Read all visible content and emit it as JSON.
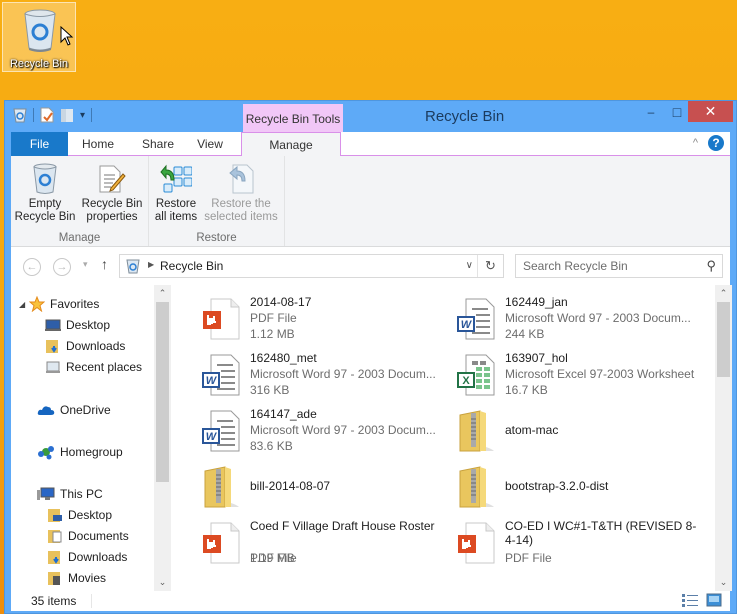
{
  "desktop": {
    "icon_label": "Recycle Bin",
    "icon": "recycle-bin-icon"
  },
  "window": {
    "title": "Recycle Bin",
    "context_tab_group": "Recycle Bin Tools",
    "controls": {
      "minimize": "–",
      "maximize": "□",
      "close": "✕"
    },
    "colors": {
      "frame": "#5eaaf7",
      "file_tab": "#1979ca",
      "context_tab": "#f1c7f7",
      "close": "#c75050"
    }
  },
  "quick_access": {
    "items": [
      {
        "icon": "recycle-bin-icon"
      },
      {
        "icon": "properties-icon"
      },
      {
        "icon": "folder-icon"
      },
      {
        "icon": "customize-dropdown-icon",
        "label": "▾"
      }
    ]
  },
  "ribbon_tabs": [
    {
      "label": "File",
      "active": false
    },
    {
      "label": "Home",
      "active": false
    },
    {
      "label": "Share",
      "active": false
    },
    {
      "label": "View",
      "active": false
    },
    {
      "label": "Manage",
      "active": true
    }
  ],
  "ribbon_right": {
    "collapse": "^",
    "help": "?"
  },
  "ribbon": {
    "groups": [
      {
        "label": "Manage",
        "buttons": [
          {
            "label_1": "Empty",
            "label_2": "Recycle Bin",
            "icon": "empty-recycle-bin-icon",
            "enabled": true
          },
          {
            "label_1": "Recycle Bin",
            "label_2": "properties",
            "icon": "properties-icon",
            "enabled": true
          }
        ]
      },
      {
        "label": "Restore",
        "buttons": [
          {
            "label_1": "Restore",
            "label_2": "all items",
            "icon": "restore-all-icon",
            "enabled": true
          },
          {
            "label_1": "Restore the",
            "label_2": "selected items",
            "icon": "restore-selected-icon",
            "enabled": false
          }
        ]
      }
    ]
  },
  "address_bar": {
    "back": "←",
    "forward": "→",
    "recent": "▾",
    "up": "↑",
    "path": "Recycle Bin",
    "dropdown": "∨",
    "refresh": "↻",
    "search_placeholder": "Search Recycle Bin",
    "search_icon": "⌕"
  },
  "nav_pane": {
    "items": [
      {
        "label": "Favorites",
        "icon": "star-icon",
        "level": 0,
        "expanded": true
      },
      {
        "label": "Desktop",
        "icon": "desktop-icon",
        "level": 1
      },
      {
        "label": "Downloads",
        "icon": "downloads-folder-icon",
        "level": 1
      },
      {
        "label": "Recent places",
        "icon": "recent-places-icon",
        "level": 1
      },
      {
        "label": "OneDrive",
        "icon": "onedrive-icon",
        "level": 0
      },
      {
        "label": "Homegroup",
        "icon": "homegroup-icon",
        "level": 0
      },
      {
        "label": "This PC",
        "icon": "this-pc-icon",
        "level": 0
      },
      {
        "label": "Desktop",
        "icon": "desktop-folder-icon",
        "level": 1
      },
      {
        "label": "Documents",
        "icon": "documents-folder-icon",
        "level": 1
      },
      {
        "label": "Downloads",
        "icon": "downloads-folder-icon",
        "level": 1
      },
      {
        "label": "Movies",
        "icon": "movies-folder-icon",
        "level": 1
      }
    ]
  },
  "files": [
    {
      "name": "2014-08-17",
      "type": "PDF File",
      "size": "1.12 MB",
      "icon": "pdf-file-icon"
    },
    {
      "name": "162449_jan",
      "type": "Microsoft Word 97 - 2003 Docum...",
      "size": "244 KB",
      "icon": "word-document-icon"
    },
    {
      "name": "162480_met",
      "type": "Microsoft Word 97 - 2003 Docum...",
      "size": "316 KB",
      "icon": "word-document-icon"
    },
    {
      "name": "163907_hol",
      "type": "Microsoft Excel 97-2003 Worksheet",
      "size": "16.7 KB",
      "icon": "excel-worksheet-icon"
    },
    {
      "name": "164147_ade",
      "type": "Microsoft Word 97 - 2003 Docum...",
      "size": "83.6 KB",
      "icon": "word-document-icon"
    },
    {
      "name": "atom-mac",
      "type": "",
      "size": "",
      "icon": "zip-folder-icon"
    },
    {
      "name": "bill-2014-08-07",
      "type": "",
      "size": "",
      "icon": "zip-folder-icon"
    },
    {
      "name": "bootstrap-3.2.0-dist",
      "type": "",
      "size": "",
      "icon": "zip-folder-icon"
    },
    {
      "name": "Coed F Village Draft House Roster",
      "type": "PDF File",
      "size": "1.19 MB",
      "icon": "pdf-file-icon"
    },
    {
      "name": "CO-ED I WC#1-T&TH (REVISED 8-4-14)",
      "type": "PDF File",
      "size": "",
      "icon": "pdf-file-icon"
    }
  ],
  "status_bar": {
    "item_count": "35 items",
    "views": [
      "details-view-icon",
      "large-icons-view-icon"
    ]
  },
  "scrollbars": {
    "nav_scroll_position": 0.0,
    "files_scroll_position": 0.0
  }
}
